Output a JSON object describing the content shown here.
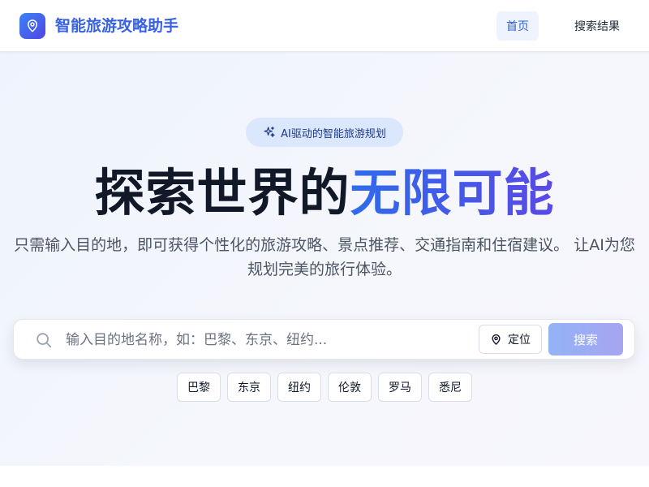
{
  "header": {
    "brand": "智能旅游攻略助手",
    "nav": [
      {
        "label": "首页"
      },
      {
        "label": "搜索结果"
      }
    ]
  },
  "hero": {
    "badge": "AI驱动的智能旅游规划",
    "headline_dark": "探索世界的",
    "headline_accent": "无限可能",
    "subtitle": "只需输入目的地，即可获得个性化的旅游攻略、景点推荐、交通指南和住宿建议。 让AI为您规划完美的旅行体验。"
  },
  "search": {
    "placeholder": "输入目的地名称，如：巴黎、东京、纽约...",
    "value": "",
    "locate_label": "定位",
    "submit_label": "搜索"
  },
  "suggestions": [
    {
      "label": "巴黎"
    },
    {
      "label": "东京"
    },
    {
      "label": "纽约"
    },
    {
      "label": "伦敦"
    },
    {
      "label": "罗马"
    },
    {
      "label": "悉尼"
    }
  ],
  "icons": {
    "logo": "map-pin-icon",
    "badge": "sparkles-icon",
    "search": "search-icon",
    "locate": "map-pin-icon"
  },
  "colors": {
    "brand": "#3662e3",
    "accent_start": "#2f6bea",
    "accent_end": "#5a48e6",
    "nav_active_bg": "#eef3fd",
    "badge_bg": "#dbe7fd"
  }
}
